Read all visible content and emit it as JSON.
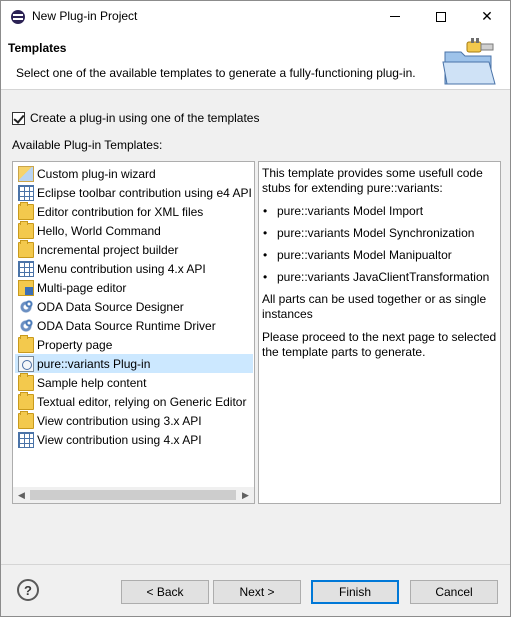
{
  "window": {
    "title": "New Plug-in Project",
    "controls": {
      "minimize": "minimize",
      "maximize": "maximize",
      "close": "✕"
    }
  },
  "header": {
    "title": "Templates",
    "description": "Select one of the available templates to generate a fully-functioning plug-in."
  },
  "options": {
    "create_checkbox_label": "Create a plug-in using one of the templates",
    "create_checkbox_checked": true,
    "available_label": "Available Plug-in Templates:"
  },
  "templates": [
    {
      "label": "Custom plug-in wizard",
      "icon": "wizard-icon"
    },
    {
      "label": "Eclipse toolbar contribution using e4 API",
      "icon": "grid-icon"
    },
    {
      "label": "Editor contribution for XML files",
      "icon": "folder-icon"
    },
    {
      "label": "Hello, World Command",
      "icon": "folder-icon"
    },
    {
      "label": "Incremental project builder",
      "icon": "folder-icon"
    },
    {
      "label": "Menu contribution using 4.x API",
      "icon": "grid-icon"
    },
    {
      "label": "Multi-page editor",
      "icon": "folder-icon"
    },
    {
      "label": "ODA Data Source Designer",
      "icon": "gear-icon"
    },
    {
      "label": "ODA Data Source Runtime Driver",
      "icon": "gear-icon"
    },
    {
      "label": "Property page",
      "icon": "folder-icon"
    },
    {
      "label": "pure::variants Plug-in",
      "icon": "plugin-icon",
      "selected": true
    },
    {
      "label": "Sample help content",
      "icon": "folder-icon"
    },
    {
      "label": "Textual editor, relying on Generic Editor",
      "icon": "folder-icon"
    },
    {
      "label": "View contribution using 3.x API",
      "icon": "folder-icon"
    },
    {
      "label": "View contribution using 4.x API",
      "icon": "grid-icon"
    }
  ],
  "description_panel": {
    "intro": "This template provides some usefull code stubs for extending pure::variants:",
    "bullets": [
      "pure::variants Model Import",
      "pure::variants Model Synchronization",
      "pure::variants Model Manipualtor",
      "pure::variants JavaClientTransformation"
    ],
    "note1": "All parts can be used together or as single instances",
    "note2": "Please proceed to the next page to selected the template parts to generate."
  },
  "footer": {
    "help": "?",
    "back": "< Back",
    "next": "Next >",
    "finish": "Finish",
    "cancel": "Cancel"
  },
  "colors": {
    "selection": "#cce8ff",
    "default_button_border": "#0078d7"
  }
}
